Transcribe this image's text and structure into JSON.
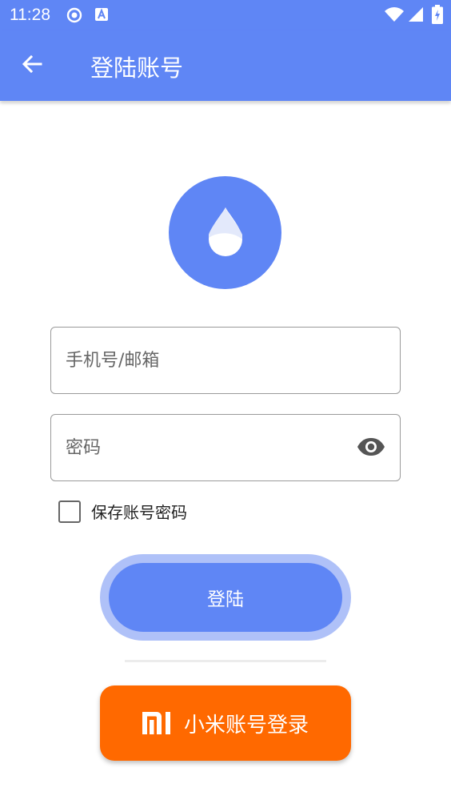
{
  "status_bar": {
    "time": "11:28",
    "icons": [
      "sync-circle-icon",
      "a-notification-icon",
      "wifi-icon",
      "signal-icon",
      "battery-charging-icon"
    ]
  },
  "app_bar": {
    "title": "登陆账号",
    "back_icon": "arrow-back-icon",
    "color": "#5f86f5"
  },
  "logo": {
    "icon": "water-drop-icon",
    "color": "#5f86f5"
  },
  "form": {
    "phone_placeholder": "手机号/邮箱",
    "phone_value": "",
    "password_placeholder": "密码",
    "password_value": "",
    "eye_icon": "eye-icon",
    "remember_label": "保存账号密码",
    "remember_checked": false
  },
  "buttons": {
    "login_label": "登陆",
    "mi_login_label": "小米账号登录",
    "mi_logo_icon": "mi-logo-icon",
    "mi_color": "#ff6900"
  }
}
